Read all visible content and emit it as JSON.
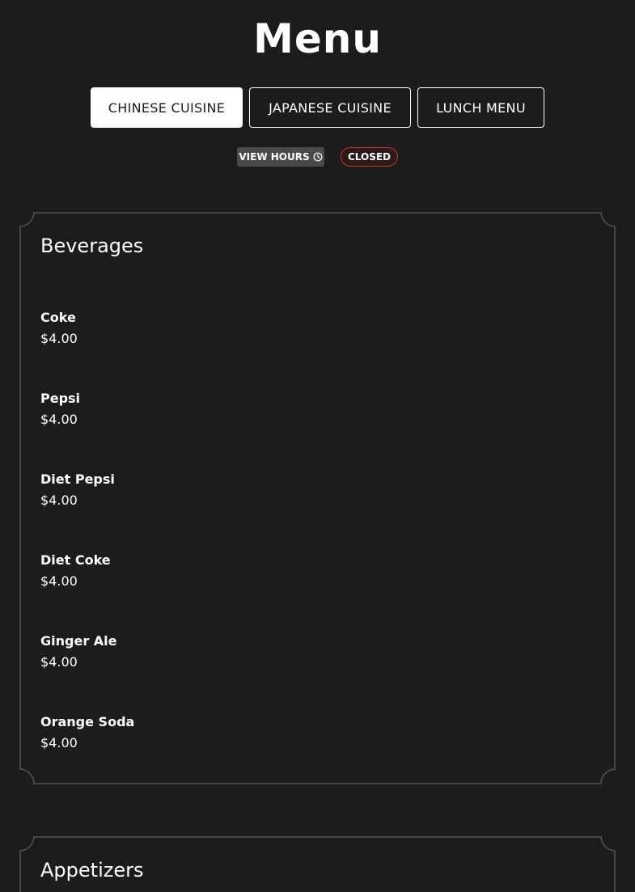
{
  "header": {
    "title": "Menu"
  },
  "tabs": [
    {
      "label": "CHINESE CUISINE",
      "active": true
    },
    {
      "label": "JAPANESE CUISINE",
      "active": false
    },
    {
      "label": "LUNCH MENU",
      "active": false
    }
  ],
  "hours": {
    "label": "VIEW HOURS",
    "icon": "clock-icon"
  },
  "status": {
    "label": "CLOSED",
    "color": "#c0392b"
  },
  "sections": [
    {
      "title": "Beverages",
      "items": [
        {
          "name": "Coke",
          "price": "$4.00"
        },
        {
          "name": "Pepsi",
          "price": "$4.00"
        },
        {
          "name": "Diet Pepsi",
          "price": "$4.00"
        },
        {
          "name": "Diet Coke",
          "price": "$4.00"
        },
        {
          "name": "Ginger Ale",
          "price": "$4.00"
        },
        {
          "name": "Orange Soda",
          "price": "$4.00"
        }
      ]
    },
    {
      "title": "Appetizers",
      "items": []
    }
  ],
  "colors": {
    "background": "#1c1c1c",
    "frame": "#555555",
    "text": "#ffffff"
  }
}
